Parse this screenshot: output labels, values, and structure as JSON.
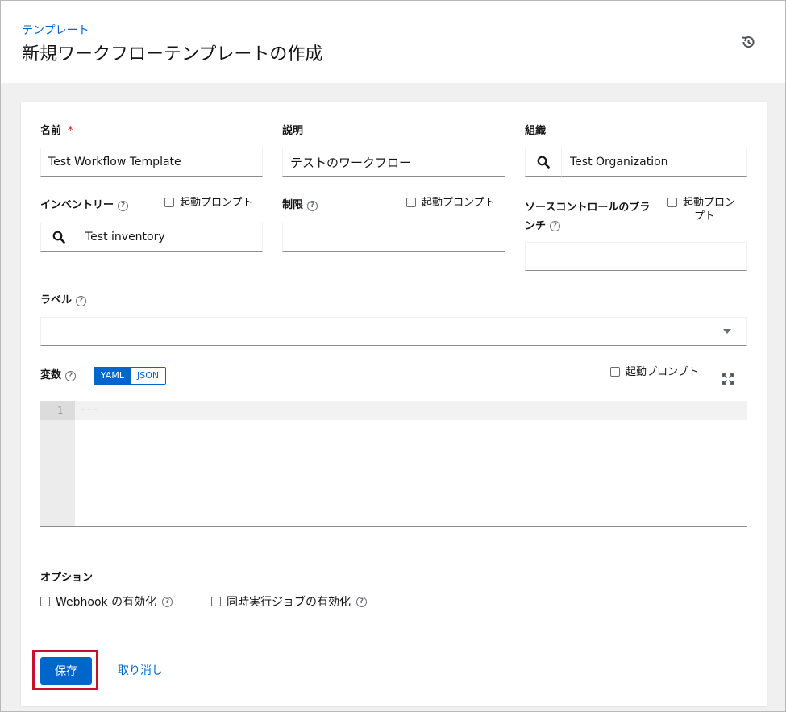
{
  "header": {
    "breadcrumb": "テンプレート",
    "title": "新規ワークフローテンプレートの作成"
  },
  "form": {
    "name": {
      "label": "名前",
      "required_mark": "*",
      "value": "Test Workflow Template"
    },
    "description": {
      "label": "説明",
      "value": "テストのワークフロー"
    },
    "organization": {
      "label": "組織",
      "value": "Test Organization"
    },
    "inventory": {
      "label": "インベントリー",
      "value": "Test inventory",
      "prompt": "起動プロンプト"
    },
    "limit": {
      "label": "制限",
      "value": "",
      "prompt": "起動プロンプト"
    },
    "scm_branch": {
      "label_line1": "ソースコントロールのブラ",
      "label_line2": "ンチ",
      "value": "",
      "prompt_line1": "起動プロン",
      "prompt_line2": "プト"
    },
    "labels": {
      "label": "ラベル"
    },
    "variables": {
      "label": "変数",
      "mode_yaml": "YAML",
      "mode_json": "JSON",
      "selected_mode": "YAML",
      "prompt": "起動プロンプト",
      "line_number": "1",
      "code": "---"
    },
    "options": {
      "label": "オプション",
      "webhook": "Webhook の有効化",
      "concurrent": "同時実行ジョブの有効化"
    }
  },
  "actions": {
    "save": "保存",
    "cancel": "取り消し"
  },
  "colors": {
    "primary": "#0066cc",
    "highlight": "#c8102e",
    "required": "#c9190b"
  }
}
